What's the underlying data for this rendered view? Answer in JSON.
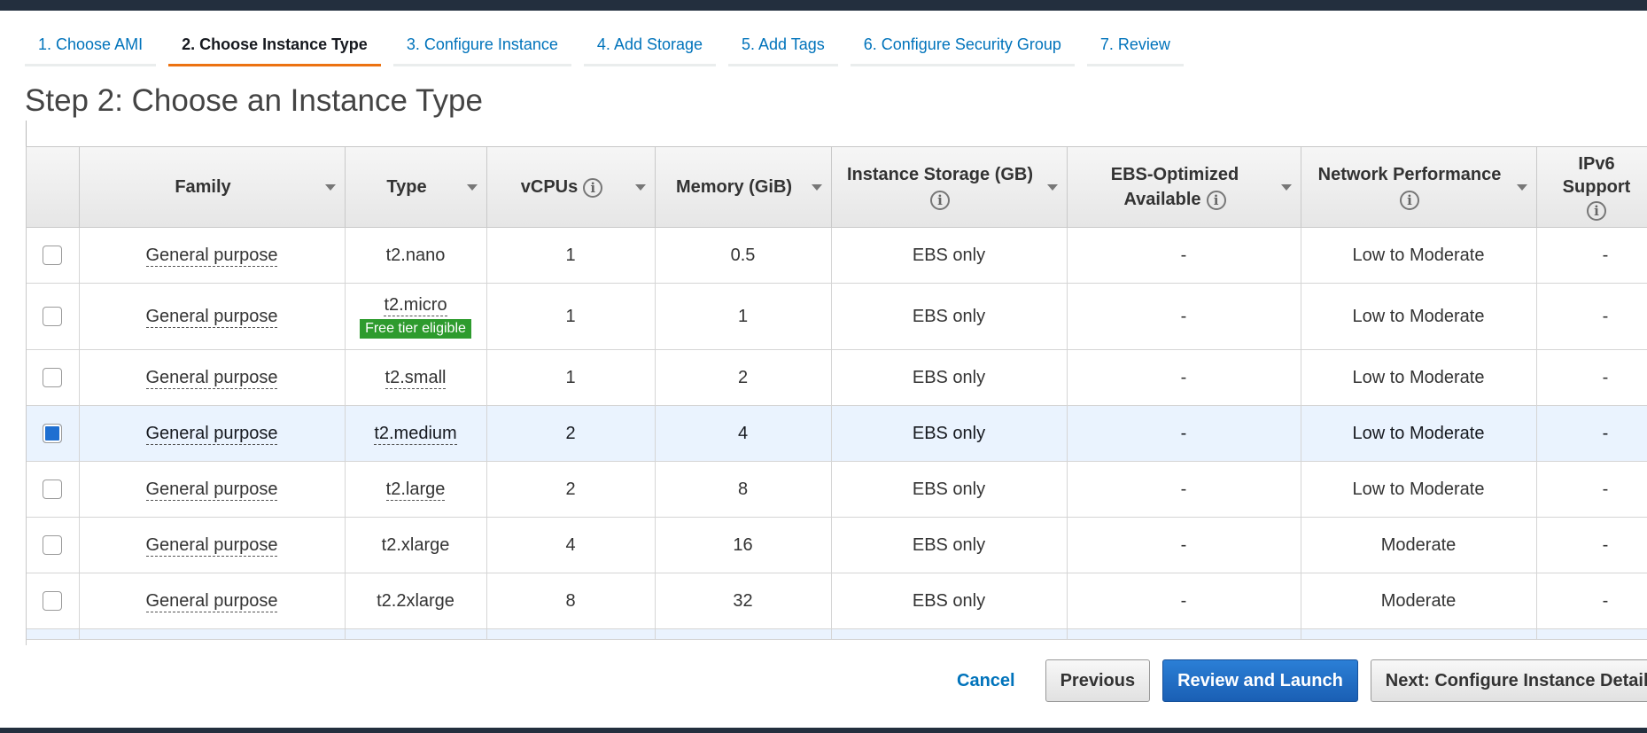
{
  "steps": [
    {
      "label": "1. Choose AMI"
    },
    {
      "label": "2. Choose Instance Type"
    },
    {
      "label": "3. Configure Instance"
    },
    {
      "label": "4. Add Storage"
    },
    {
      "label": "5. Add Tags"
    },
    {
      "label": "6. Configure Security Group"
    },
    {
      "label": "7. Review"
    }
  ],
  "page_title": "Step 2: Choose an Instance Type",
  "columns": {
    "family": "Family",
    "type": "Type",
    "vcpus": "vCPUs",
    "memory": "Memory (GiB)",
    "storage": "Instance Storage (GB)",
    "ebs_1": "EBS-Optimized",
    "ebs_2": "Available",
    "network": "Network Performance",
    "ipv6_1": "IPv6",
    "ipv6_2": "Support"
  },
  "info_glyph": "i",
  "rows": [
    {
      "family": "General purpose",
      "type": "t2.nano",
      "vcpus": "1",
      "memory": "0.5",
      "storage": "EBS only",
      "ebs": "-",
      "network": "Low to Moderate",
      "ipv6": "-"
    },
    {
      "family": "General purpose",
      "type": "t2.micro",
      "badge": "Free tier eligible",
      "vcpus": "1",
      "memory": "1",
      "storage": "EBS only",
      "ebs": "-",
      "network": "Low to Moderate",
      "ipv6": "-"
    },
    {
      "family": "General purpose",
      "type": "t2.small",
      "vcpus": "1",
      "memory": "2",
      "storage": "EBS only",
      "ebs": "-",
      "network": "Low to Moderate",
      "ipv6": "-"
    },
    {
      "family": "General purpose",
      "type": "t2.medium",
      "vcpus": "2",
      "memory": "4",
      "storage": "EBS only",
      "ebs": "-",
      "network": "Low to Moderate",
      "ipv6": "-",
      "selected": true
    },
    {
      "family": "General purpose",
      "type": "t2.large",
      "vcpus": "2",
      "memory": "8",
      "storage": "EBS only",
      "ebs": "-",
      "network": "Low to Moderate",
      "ipv6": "-"
    },
    {
      "family": "General purpose",
      "type": "t2.xlarge",
      "vcpus": "4",
      "memory": "16",
      "storage": "EBS only",
      "ebs": "-",
      "network": "Moderate",
      "ipv6": "-"
    },
    {
      "family": "General purpose",
      "type": "t2.2xlarge",
      "vcpus": "8",
      "memory": "32",
      "storage": "EBS only",
      "ebs": "-",
      "network": "Moderate",
      "ipv6": "-"
    }
  ],
  "footer": {
    "cancel": "Cancel",
    "previous": "Previous",
    "review": "Review and Launch",
    "next": "Next: Configure Instance Details"
  },
  "colors": {
    "accent_tab": "#ec7211",
    "link": "#0073bb",
    "primary_button": "#1f6fd1",
    "free_tier_badge": "#2e9b2e",
    "selected_row": "#eaf3fe"
  },
  "icons": {
    "info": "info-icon",
    "sort": "sort-caret-icon",
    "checkbox": "checkbox-icon"
  }
}
